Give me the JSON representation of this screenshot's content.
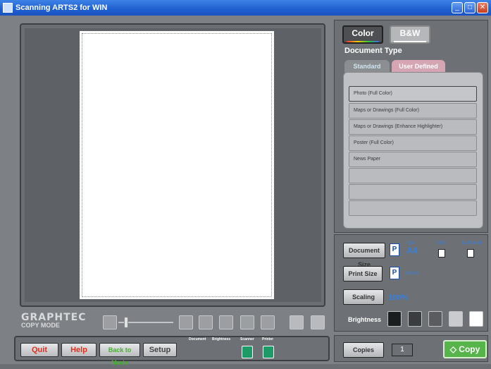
{
  "window": {
    "title": "Scanning ARTS2 for WIN",
    "buttons": {
      "minimize": "_",
      "maximize": "□",
      "close": "✕"
    }
  },
  "logo": {
    "line1": "GRAPHTEC",
    "line2": "COPY MODE"
  },
  "bottom": {
    "quit": "Quit",
    "help": "Help",
    "back": "Back to Mode",
    "setup": "Setup",
    "document_label": "Document",
    "brightness_label": "Brightness",
    "scanner_label": "Scanner",
    "printer_label": "Printer"
  },
  "mode": {
    "color": "Color",
    "bw": "B&W"
  },
  "document_type": {
    "label": "Document Type",
    "tabs": [
      "Standard",
      "User Defined"
    ],
    "items": [
      "Photo (Full Color)",
      "Maps or Drawings (Full Color)",
      "Maps or Drawings (Enhance Highlighter)",
      "Poster (Full Color)",
      "News Paper",
      "",
      "",
      ""
    ]
  },
  "settings": {
    "document_size_label": "Document Size",
    "document_size_iso": "ISO",
    "document_size_value": "A4",
    "size_w": "8.27 i",
    "size_h": "11.69 inch",
    "print_size_label": "Print Size",
    "print_size_value": "ISO A4",
    "scaling_label": "Scaling",
    "scaling_value": "100%",
    "brightness_label": "Brightness",
    "p_icon": "P"
  },
  "copies": {
    "label": "Copies",
    "value": "1",
    "copy_button": "Copy"
  },
  "colors": {
    "titlebar": "#1f5fd0",
    "copy_button": "#57b44a",
    "swatches": [
      "#1c1d1f",
      "#3a3c3f",
      "#5a5c60",
      "#c9cbce",
      "#ffffff"
    ]
  }
}
